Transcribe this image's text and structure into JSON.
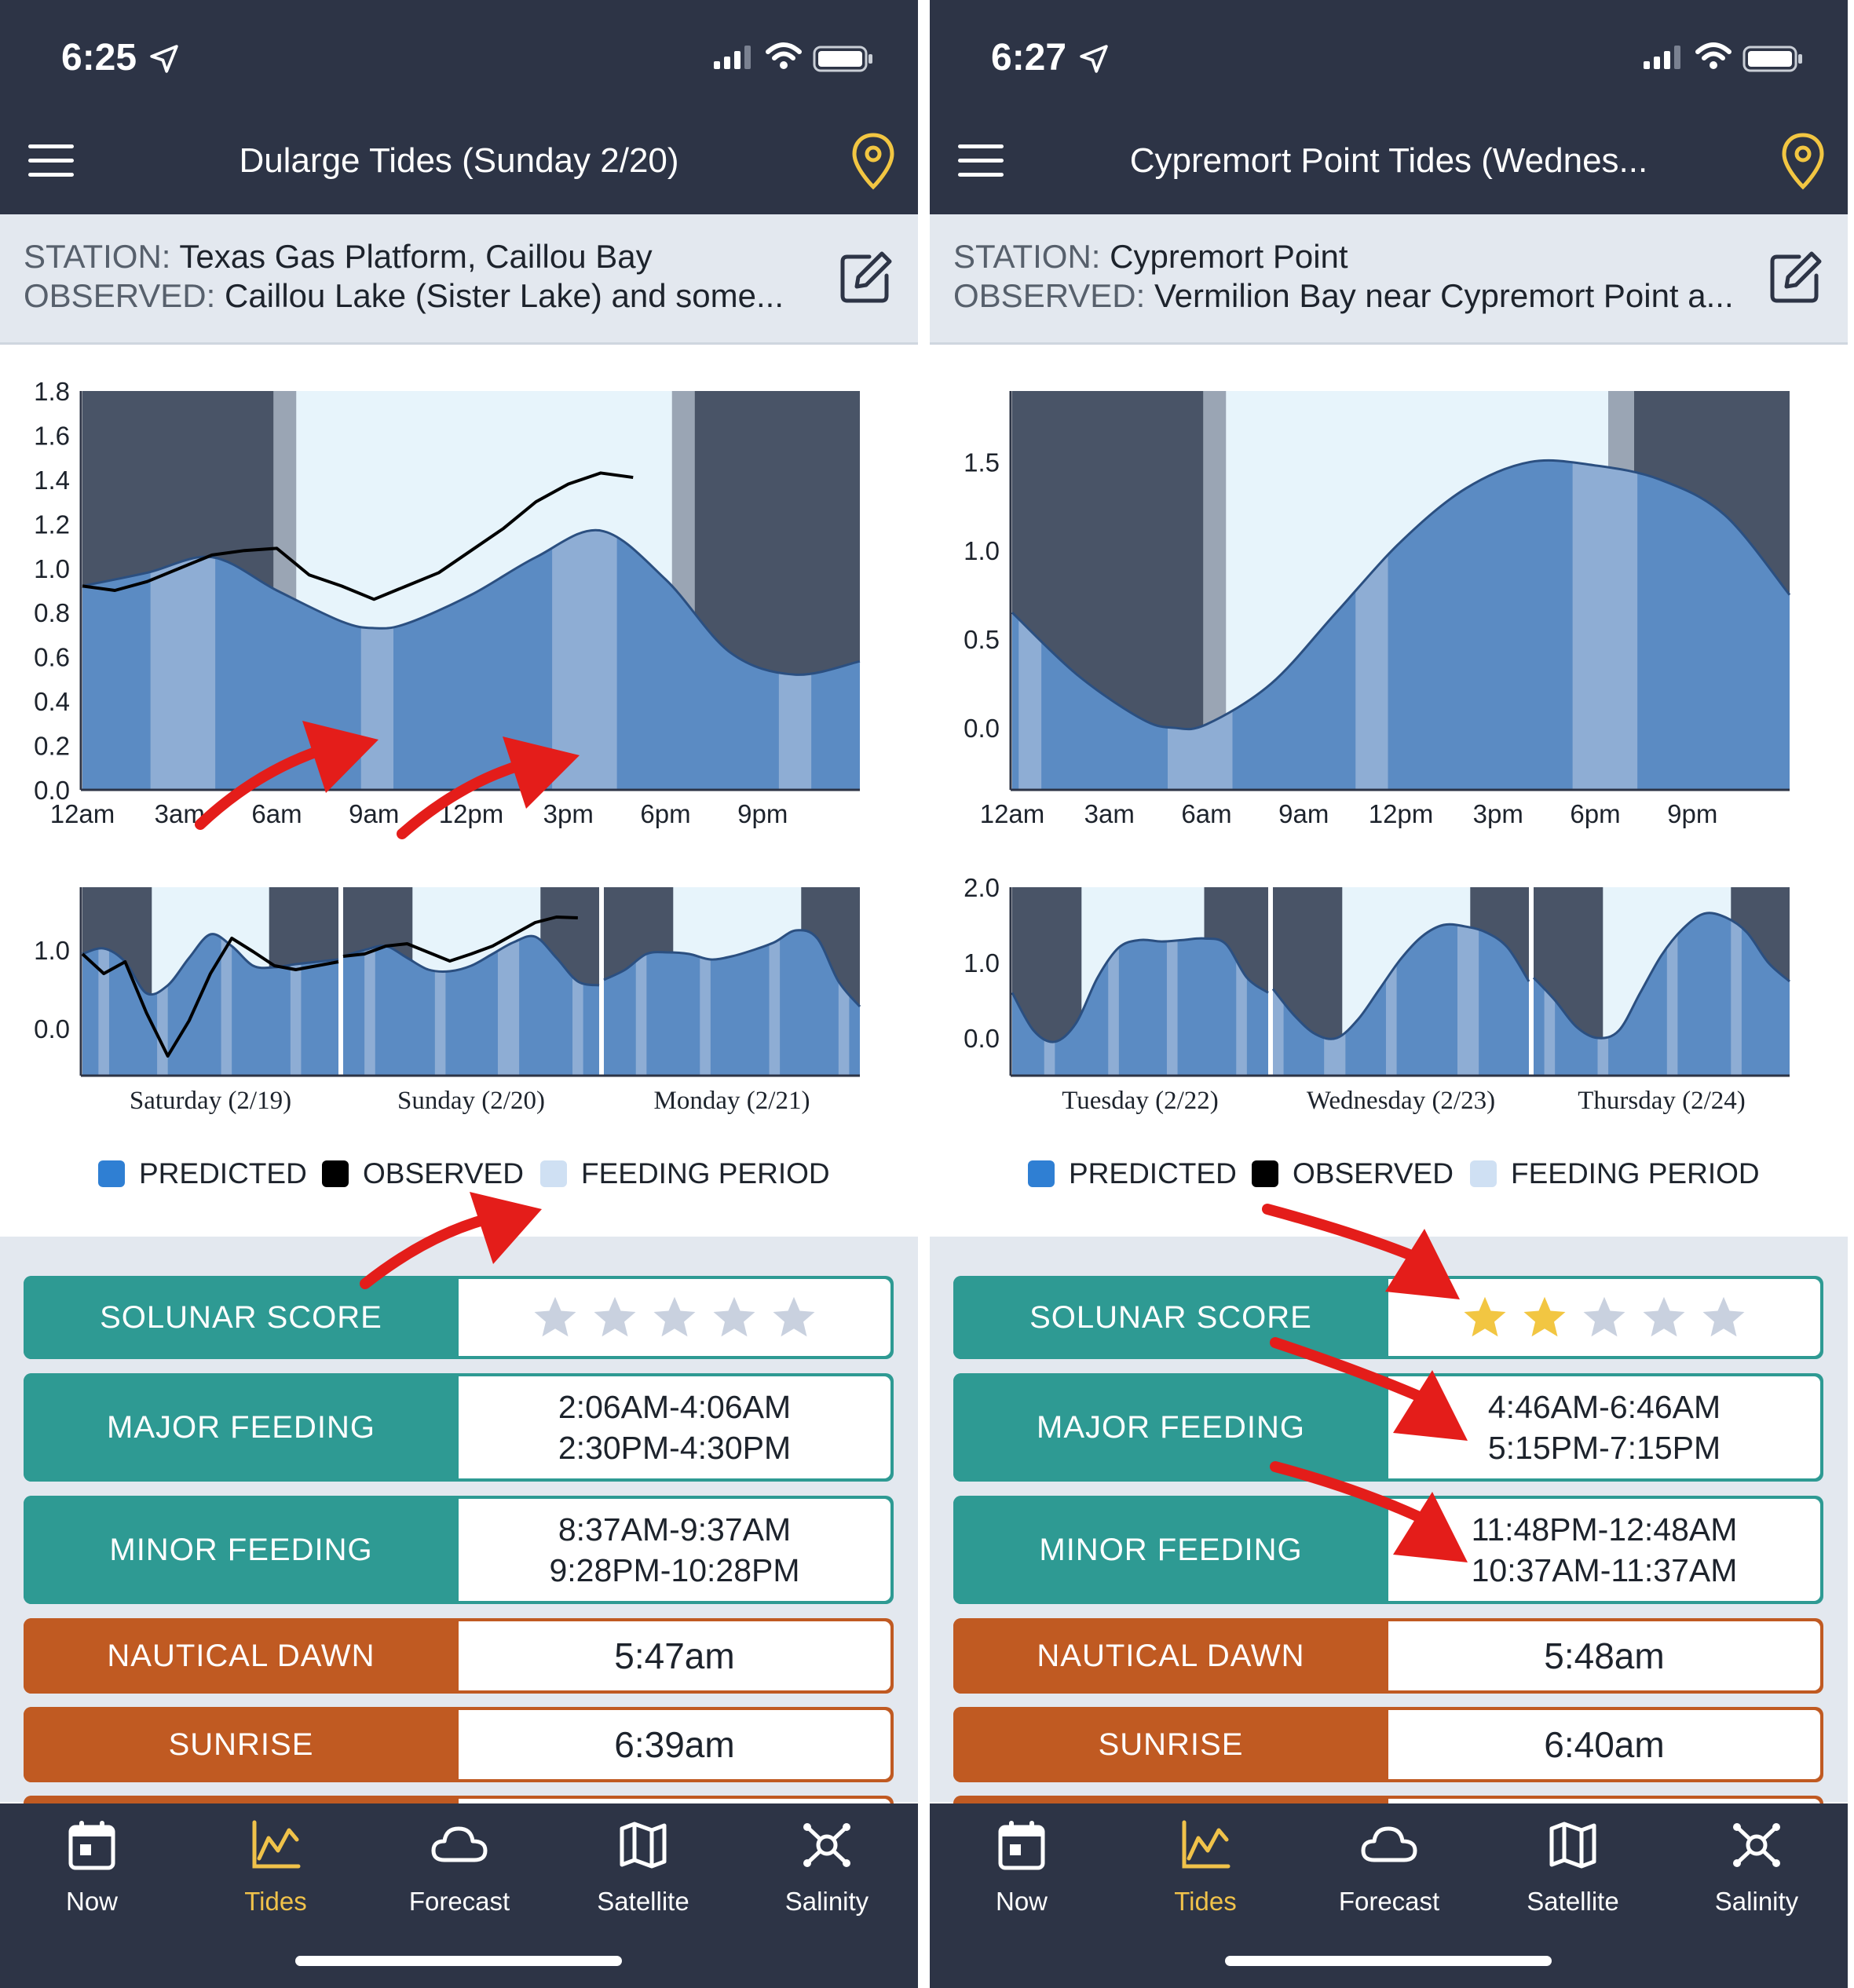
{
  "colors": {
    "header_bg": "#2d3446",
    "station_bg": "#e3e8ef",
    "predicted": "#5b8bc3",
    "feeding": "#8eadd4",
    "night": "#495467",
    "twilight": "#9aa5b4",
    "sky": "#e7f4fb",
    "teal": "#2e9a93",
    "orange": "#c05a22",
    "star_gold": "#f2c642",
    "star_gray": "#c9d1df",
    "active_tab": "#f0c24a",
    "annotation_arrow": "#e41d1a"
  },
  "screens": [
    {
      "status": {
        "time": "6:25"
      },
      "nav_title": "Dularge Tides (Sunday 2/20)",
      "station": {
        "station_label": "STATION:",
        "station_value": "Texas Gas Platform, Caillou Bay",
        "observed_label": "OBSERVED:",
        "observed_value": "Caillou Lake (Sister Lake) and some..."
      },
      "chart_data": [
        {
          "type": "area",
          "x_tick_labels": [
            "12am",
            "3am",
            "6am",
            "9am",
            "12pm",
            "3pm",
            "6pm",
            "9pm"
          ],
          "y_tick_labels": [
            "0.0",
            "0.2",
            "0.4",
            "0.6",
            "0.8",
            "1.0",
            "1.2",
            "1.4",
            "1.6",
            "1.8"
          ],
          "ylim": [
            0,
            1.8
          ],
          "x_unit": "hour of day",
          "series": [
            {
              "name": "PREDICTED",
              "x": [
                0,
                2,
                4,
                6,
                8,
                9,
                10,
                12,
                14,
                16,
                18,
                20,
                22,
                24
              ],
              "values": [
                0.92,
                0.98,
                1.05,
                0.9,
                0.76,
                0.73,
                0.75,
                0.88,
                1.05,
                1.17,
                0.95,
                0.62,
                0.52,
                0.58
              ]
            },
            {
              "name": "OBSERVED",
              "x": [
                0,
                1,
                2,
                3,
                4,
                5,
                6,
                7,
                8,
                9,
                10,
                11,
                12,
                13,
                14,
                15,
                16,
                17
              ],
              "values": [
                0.92,
                0.9,
                0.94,
                1.0,
                1.06,
                1.08,
                1.09,
                0.97,
                0.92,
                0.86,
                0.92,
                0.98,
                1.08,
                1.18,
                1.3,
                1.38,
                1.43,
                1.41
              ]
            }
          ],
          "night_hours": [
            [
              0,
              5.9
            ],
            [
              18.9,
              24
            ]
          ],
          "twilight_hours": [
            [
              5.9,
              6.6
            ],
            [
              18.2,
              18.9
            ]
          ],
          "feeding_hours": [
            [
              2.1,
              4.1
            ],
            [
              8.6,
              9.6
            ],
            [
              14.5,
              16.5
            ],
            [
              21.5,
              22.5
            ]
          ]
        },
        {
          "type": "area",
          "x_tick_labels": [
            "Saturday (2/19)",
            "Sunday (2/20)",
            "Monday (2/21)"
          ],
          "y_tick_labels": [
            "0.0",
            "1.0"
          ],
          "ylim": [
            -0.6,
            1.8
          ],
          "days": [
            {
              "label": "Saturday (2/19)",
              "predicted": [
                0.95,
                1.02,
                0.85,
                0.45,
                0.55,
                0.9,
                1.2,
                1.05,
                0.8,
                0.78,
                0.82,
                0.85,
                0.88
              ],
              "observed": [
                0.95,
                0.7,
                0.85,
                0.2,
                -0.35,
                0.1,
                0.7,
                1.15,
                0.98,
                0.8,
                0.75,
                0.8,
                0.85
              ],
              "night_hours": [
                [
                  0,
                  6.5
                ],
                [
                  17.5,
                  24
                ]
              ],
              "feeding_hours": [
                [
                  1.5,
                  2.5
                ],
                [
                  7,
                  8
                ],
                [
                  13,
                  14
                ],
                [
                  19.5,
                  20.5
                ]
              ]
            },
            {
              "label": "Sunday (2/20)",
              "predicted": [
                0.92,
                1.0,
                1.05,
                0.9,
                0.75,
                0.73,
                0.8,
                0.95,
                1.1,
                1.17,
                0.9,
                0.6,
                0.55
              ],
              "observed": [
                0.92,
                0.95,
                1.05,
                1.08,
                0.97,
                0.86,
                0.95,
                1.05,
                1.2,
                1.35,
                1.42,
                1.41,
                null
              ],
              "night_hours": [
                [
                  0,
                  6.5
                ],
                [
                  18.5,
                  24
                ]
              ],
              "feeding_hours": [
                [
                  2,
                  3
                ],
                [
                  8.6,
                  9.6
                ],
                [
                  14.5,
                  16.5
                ],
                [
                  21.5,
                  22.5
                ]
              ]
            },
            {
              "label": "Monday (2/21)",
              "predicted": [
                0.62,
                0.75,
                0.95,
                0.97,
                0.95,
                0.88,
                0.92,
                1.0,
                1.1,
                1.25,
                1.15,
                0.6,
                0.28
              ],
              "observed": [],
              "night_hours": [
                [
                  0,
                  6.5
                ],
                [
                  18.5,
                  24
                ]
              ],
              "feeding_hours": [
                [
                  3,
                  4
                ],
                [
                  9,
                  10
                ],
                [
                  15.5,
                  16.5
                ],
                [
                  22,
                  23
                ]
              ]
            }
          ]
        }
      ],
      "legend": {
        "predicted": "PREDICTED",
        "observed": "OBSERVED",
        "feeding": "FEEDING PERIOD"
      },
      "rows": {
        "solunar": {
          "label": "SOLUNAR SCORE",
          "stars": 0,
          "max_stars": 5
        },
        "major": {
          "label": "MAJOR FEEDING",
          "line1": "2:06AM-4:06AM",
          "line2": "2:30PM-4:30PM"
        },
        "minor": {
          "label": "MINOR FEEDING",
          "line1": "8:37AM-9:37AM",
          "line2": "9:28PM-10:28PM"
        },
        "dawn": {
          "label": "NAUTICAL DAWN",
          "value": "5:47am"
        },
        "sunrise": {
          "label": "SUNRISE",
          "value": "6:39am"
        }
      }
    },
    {
      "status": {
        "time": "6:27"
      },
      "nav_title": "Cypremort Point Tides (Wednes...",
      "station": {
        "station_label": "STATION:",
        "station_value": "Cypremort Point",
        "observed_label": "OBSERVED:",
        "observed_value": "Vermilion Bay near Cypremort Point a..."
      },
      "chart_data": [
        {
          "type": "area",
          "x_tick_labels": [
            "12am",
            "3am",
            "6am",
            "9am",
            "12pm",
            "3pm",
            "6pm",
            "9pm"
          ],
          "y_tick_labels": [
            "0.0",
            "0.5",
            "1.0",
            "1.5"
          ],
          "ylim": [
            -0.35,
            1.9
          ],
          "x_unit": "hour of day",
          "series": [
            {
              "name": "PREDICTED",
              "x": [
                0,
                2,
                4,
                5,
                6,
                8,
                10,
                12,
                14,
                16,
                18,
                20,
                22,
                24
              ],
              "values": [
                0.65,
                0.3,
                0.05,
                0.0,
                0.02,
                0.25,
                0.65,
                1.05,
                1.35,
                1.5,
                1.48,
                1.4,
                1.2,
                0.75
              ]
            }
          ],
          "night_hours": [
            [
              0,
              5.9
            ],
            [
              19.2,
              24
            ]
          ],
          "twilight_hours": [
            [
              5.9,
              6.6
            ],
            [
              18.4,
              19.2
            ]
          ],
          "feeding_hours": [
            [
              0.2,
              0.9
            ],
            [
              4.8,
              6.8
            ],
            [
              10.6,
              11.6
            ],
            [
              17.3,
              19.3
            ]
          ]
        },
        {
          "type": "area",
          "x_tick_labels": [
            "Tuesday (2/22)",
            "Wednesday (2/23)",
            "Thursday (2/24)"
          ],
          "y_tick_labels": [
            "0.0",
            "1.0",
            "2.0"
          ],
          "ylim": [
            -0.5,
            2.0
          ],
          "days": [
            {
              "label": "Tuesday (2/22)",
              "predicted": [
                0.6,
                0.1,
                -0.05,
                0.2,
                0.8,
                1.2,
                1.3,
                1.28,
                1.3,
                1.32,
                1.25,
                0.8,
                0.6
              ],
              "observed": [],
              "night_hours": [
                [
                  0,
                  6.5
                ],
                [
                  18,
                  24
                ]
              ],
              "feeding_hours": [
                [
                  3,
                  4
                ],
                [
                  9,
                  10
                ],
                [
                  14.5,
                  15.5
                ],
                [
                  21,
                  22
                ]
              ]
            },
            {
              "label": "Wednesday (2/23)",
              "predicted": [
                0.65,
                0.3,
                0.05,
                0.0,
                0.25,
                0.65,
                1.05,
                1.35,
                1.5,
                1.48,
                1.4,
                1.2,
                0.75
              ],
              "observed": [],
              "night_hours": [
                [
                  0,
                  6.5
                ],
                [
                  18.5,
                  24
                ]
              ],
              "feeding_hours": [
                [
                  0,
                  1
                ],
                [
                  4.8,
                  6.8
                ],
                [
                  10.6,
                  11.6
                ],
                [
                  17.3,
                  19.3
                ]
              ]
            },
            {
              "label": "Thursday (2/24)",
              "predicted": [
                0.8,
                0.5,
                0.15,
                0.0,
                0.1,
                0.6,
                1.1,
                1.45,
                1.65,
                1.6,
                1.4,
                1.0,
                0.75
              ],
              "observed": [],
              "night_hours": [
                [
                  0,
                  6.5
                ],
                [
                  18.5,
                  24
                ]
              ],
              "feeding_hours": [
                [
                  1,
                  2
                ],
                [
                  6,
                  7
                ],
                [
                  12.5,
                  13.5
                ],
                [
                  18.5,
                  19.5
                ]
              ]
            }
          ]
        }
      ],
      "legend": {
        "predicted": "PREDICTED",
        "observed": "OBSERVED",
        "feeding": "FEEDING PERIOD"
      },
      "rows": {
        "solunar": {
          "label": "SOLUNAR SCORE",
          "stars": 2,
          "max_stars": 5
        },
        "major": {
          "label": "MAJOR FEEDING",
          "line1": "4:46AM-6:46AM",
          "line2": "5:15PM-7:15PM"
        },
        "minor": {
          "label": "MINOR FEEDING",
          "line1": "11:48PM-12:48AM",
          "line2": "10:37AM-11:37AM"
        },
        "dawn": {
          "label": "NAUTICAL DAWN",
          "value": "5:48am"
        },
        "sunrise": {
          "label": "SUNRISE",
          "value": "6:40am"
        }
      }
    }
  ],
  "tabs": [
    {
      "label": "Now",
      "icon": "calendar-icon"
    },
    {
      "label": "Tides",
      "icon": "line-chart-icon",
      "active": true
    },
    {
      "label": "Forecast",
      "icon": "cloud-icon"
    },
    {
      "label": "Satellite",
      "icon": "map-icon"
    },
    {
      "label": "Salinity",
      "icon": "salinity-icon"
    }
  ]
}
